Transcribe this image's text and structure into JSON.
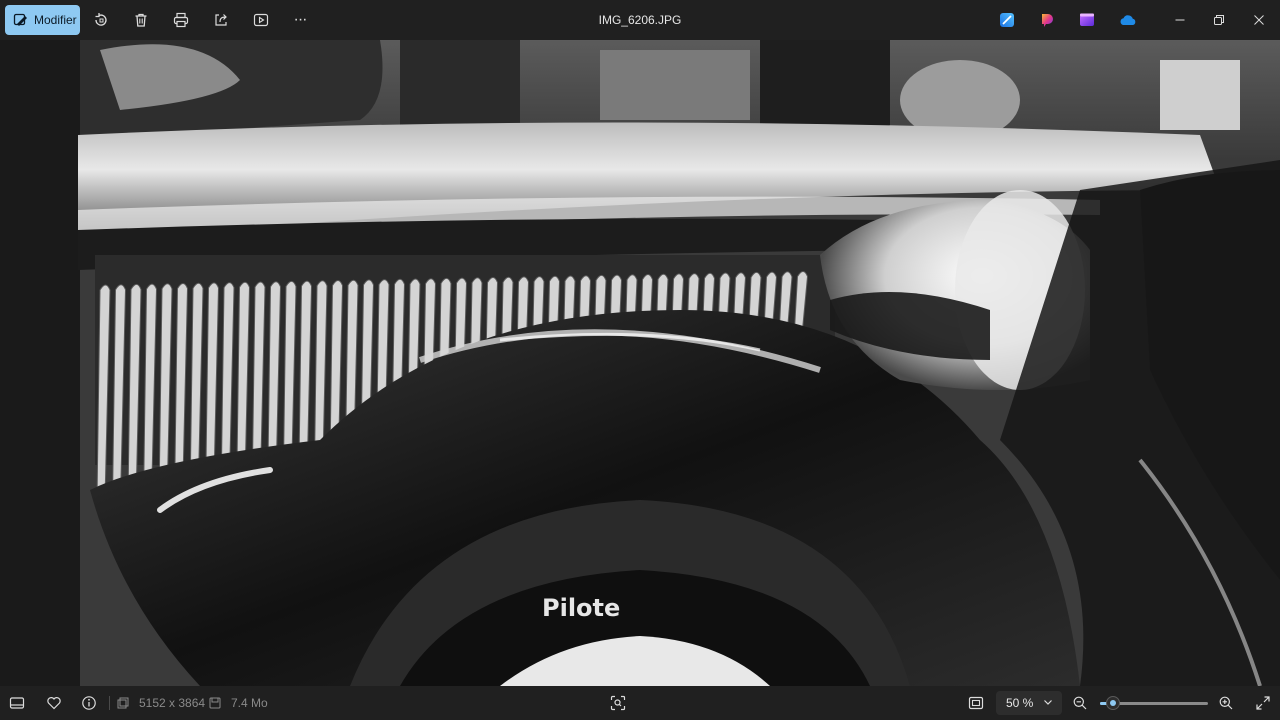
{
  "toolbar": {
    "edit_label": "Modifier",
    "file_title": "IMG_6206.JPG",
    "more_label": "···"
  },
  "photo": {
    "tire_brand": "Pilote",
    "description_colors": {
      "dark": "#161616",
      "chrome": "#d8d8d8",
      "mid": "#6a6a6a"
    }
  },
  "statusbar": {
    "dimensions": "5152 x 3864",
    "file_size": "7.4 Mo",
    "zoom_value": "50 %",
    "zoom_fraction": 0.12
  },
  "colors": {
    "accent": "#8ec9f2",
    "bar_bg": "#202020"
  },
  "icons": {
    "toolbar": [
      "edit-image-icon",
      "rotate-icon",
      "delete-icon",
      "print-icon",
      "share-icon",
      "slideshow-icon",
      "more-icon"
    ],
    "apps": [
      "designer-icon",
      "copilot-icon",
      "clipchamp-icon",
      "onedrive-icon"
    ],
    "bottom": [
      "filmstrip-icon",
      "favorite-icon",
      "info-icon",
      "dimensions-icon",
      "filesize-icon",
      "visual-search-icon",
      "fit-window-icon",
      "zoom-out-icon",
      "zoom-in-icon",
      "fullscreen-icon"
    ]
  }
}
